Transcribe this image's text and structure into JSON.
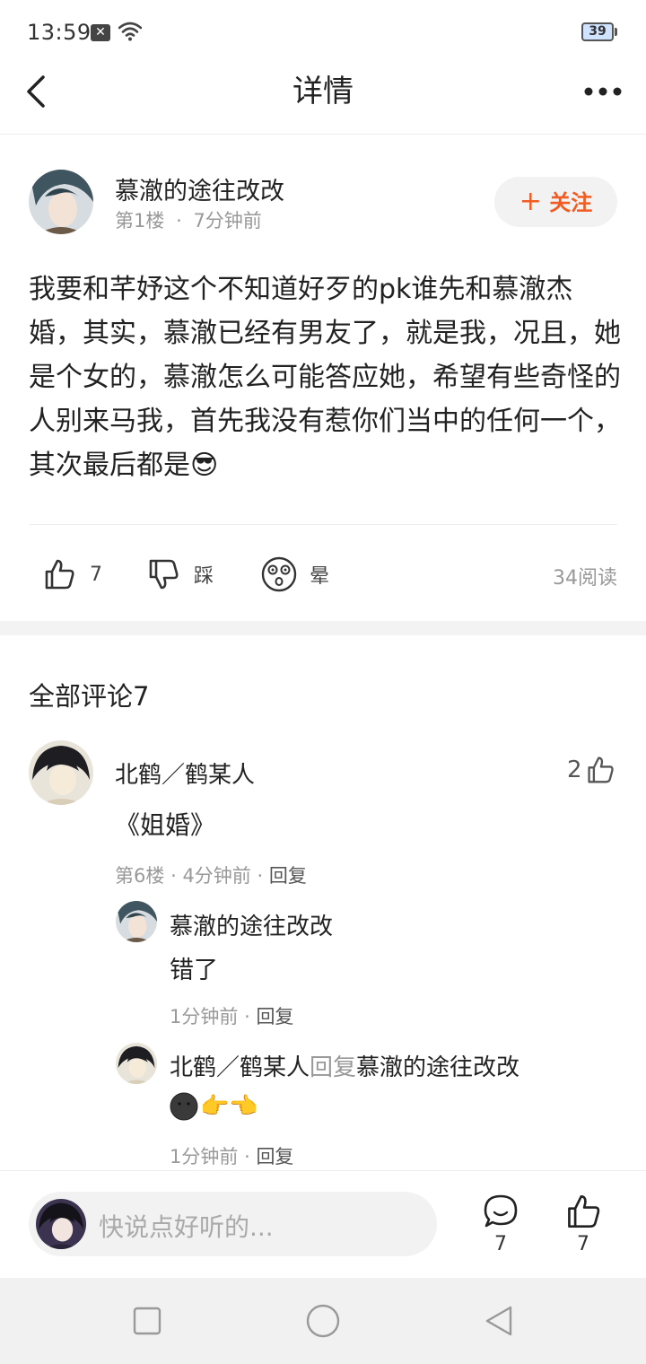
{
  "status_bar": {
    "time": "13:59",
    "battery": "39",
    "notification_glyph": "✕"
  },
  "header": {
    "title": "详情"
  },
  "post": {
    "author": "慕澈的途往改改",
    "floor": "第1楼",
    "time": "7分钟前",
    "separator": "·",
    "follow_label": "关注",
    "content": "我要和芊妤这个不知道好歹的pk谁先和慕澈杰婚，其实，慕澈已经有男友了，就是我，况且，她是个女的，慕澈怎么可能答应她，希望有些奇怪的人别来马我，首先我没有惹你们当中的任何一个，其次最后都是",
    "content_emoji": "😎",
    "actions": {
      "like_count": "7",
      "dislike_label": "踩",
      "dizzy_label": "晕"
    },
    "read_count": "34阅读"
  },
  "comments": {
    "title": "全部评论7",
    "items": [
      {
        "author": "北鹤／鹤某人",
        "text": "《姐婚》",
        "floor": "第6楼",
        "time": "4分钟前",
        "reply_label": "回复",
        "like_count": "2",
        "replies": [
          {
            "author": "慕澈的途往改改",
            "text": "错了",
            "time": "1分钟前",
            "reply_label": "回复"
          },
          {
            "author": "北鹤／鹤某人",
            "reply_word": "回复",
            "reply_to": "慕澈的途往改改",
            "emojis": "👉👈",
            "time": "1分钟前",
            "reply_label": "回复"
          }
        ]
      }
    ]
  },
  "bottom_bar": {
    "placeholder": "快说点好听的...",
    "comment_count": "7",
    "like_count": "7"
  },
  "colors": {
    "accent": "#f25c22",
    "meta": "#999999"
  },
  "icons": [
    "back-icon",
    "more-icon",
    "wifi-icon",
    "like-icon",
    "dislike-icon",
    "dizzy-icon",
    "comment-icon",
    "nav-square-icon",
    "nav-circle-icon",
    "nav-back-triangle-icon"
  ]
}
